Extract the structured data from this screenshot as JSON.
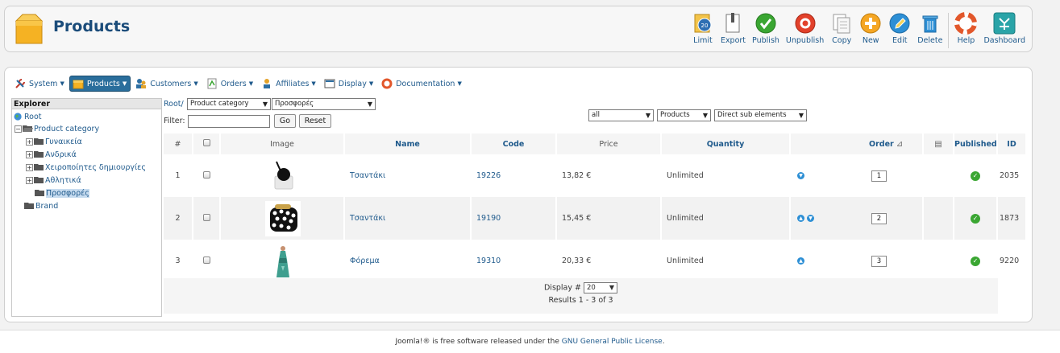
{
  "header": {
    "title": "Products",
    "toolbar": [
      {
        "id": "limit",
        "label": "Limit",
        "icon": "calendar-limit-icon"
      },
      {
        "id": "export",
        "label": "Export",
        "icon": "export-icon"
      },
      {
        "id": "publish",
        "label": "Publish",
        "icon": "publish-check-icon"
      },
      {
        "id": "unpublish",
        "label": "Unpublish",
        "icon": "unpublish-icon"
      },
      {
        "id": "copy",
        "label": "Copy",
        "icon": "copy-icon"
      },
      {
        "id": "new",
        "label": "New",
        "icon": "new-plus-icon"
      },
      {
        "id": "edit",
        "label": "Edit",
        "icon": "edit-pencil-icon"
      },
      {
        "id": "delete",
        "label": "Delete",
        "icon": "trash-icon"
      },
      {
        "id": "help",
        "label": "Help",
        "icon": "lifebuoy-icon"
      },
      {
        "id": "dashboard",
        "label": "Dashboard",
        "icon": "dashboard-icon"
      }
    ]
  },
  "menu": [
    {
      "label": "System",
      "icon": "wrench-icon"
    },
    {
      "label": "Products",
      "icon": "box-icon",
      "active": true
    },
    {
      "label": "Customers",
      "icon": "users-icon"
    },
    {
      "label": "Orders",
      "icon": "orders-icon"
    },
    {
      "label": "Affiliates",
      "icon": "affiliates-icon"
    },
    {
      "label": "Display",
      "icon": "display-icon"
    },
    {
      "label": "Documentation",
      "icon": "lifebuoy-icon"
    }
  ],
  "explorer": {
    "title": "Explorer",
    "root": "Root",
    "category": "Product category",
    "children": [
      "Γυναικεία",
      "Ανδρικά",
      "Χειροποίητες δημιουργίες",
      "Αθλητικά",
      "Προσφορές"
    ],
    "brand": "Brand"
  },
  "filters": {
    "breadcrumb_root": "Root/",
    "type_select": "Product category",
    "category_select": "Προσφορές",
    "filter_label": "Filter:",
    "filter_value": "",
    "go_label": "Go",
    "reset_label": "Reset",
    "scope_select": "all",
    "entity_select": "Products",
    "depth_select": "Direct sub elements"
  },
  "table": {
    "headers": {
      "num": "#",
      "image": "Image",
      "name": "Name",
      "code": "Code",
      "price": "Price",
      "quantity": "Quantity",
      "order": "Order",
      "published": "Published",
      "id": "ID"
    },
    "rows": [
      {
        "num": "1",
        "name": "Τσαντάκι",
        "code": "19226",
        "price": "13,82 €",
        "quantity": "Unlimited",
        "order": "1",
        "id": "2035",
        "img": "bag-black"
      },
      {
        "num": "2",
        "name": "Τσαντάκι",
        "code": "19190",
        "price": "15,45 €",
        "quantity": "Unlimited",
        "order": "2",
        "id": "1873",
        "img": "bag-dots"
      },
      {
        "num": "3",
        "name": "Φόρεμα",
        "code": "19310",
        "price": "20,33 €",
        "quantity": "Unlimited",
        "order": "3",
        "id": "9220",
        "img": "dress"
      }
    ]
  },
  "pagination": {
    "display_label": "Display #",
    "display_value": "20",
    "results": "Results 1 - 3 of 3"
  },
  "footer": {
    "pre": "Joomla!® is free software released under the ",
    "link": "GNU General Public License",
    "post": "."
  }
}
